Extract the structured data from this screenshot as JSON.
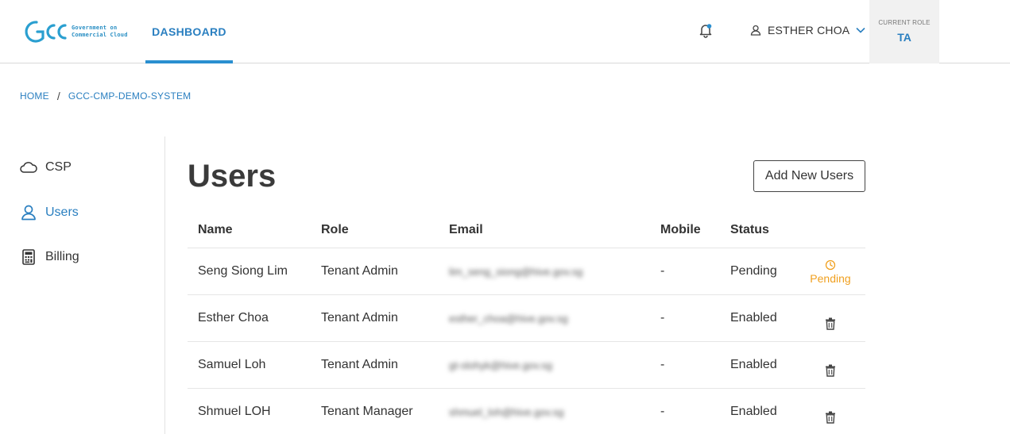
{
  "header": {
    "logo": {
      "mark": "GCC",
      "line1": "Government on",
      "line2": "Commercial Cloud"
    },
    "nav_tab": "DASHBOARD",
    "bell_icon": "bell-icon",
    "user_name": "ESTHER CHOA",
    "role_label": "CURRENT ROLE",
    "role_value": "TA"
  },
  "breadcrumb": {
    "home": "HOME",
    "separator": "/",
    "current": "GCC-CMP-DEMO-SYSTEM"
  },
  "sidebar": {
    "items": [
      {
        "label": "CSP",
        "icon": "cloud-icon",
        "active": false
      },
      {
        "label": "Users",
        "icon": "user-icon",
        "active": true
      },
      {
        "label": "Billing",
        "icon": "calculator-icon",
        "active": false
      }
    ]
  },
  "main": {
    "title": "Users",
    "add_button": "Add New Users",
    "columns": [
      "Name",
      "Role",
      "Email",
      "Mobile",
      "Status"
    ],
    "rows": [
      {
        "name": "Seng Siong Lim",
        "role": "Tenant Admin",
        "email": "lim_seng_siong@hive.gov.sg",
        "mobile": "-",
        "status": "Pending",
        "action": "Pending",
        "action_icon": "clock-icon"
      },
      {
        "name": "Esther Choa",
        "role": "Tenant Admin",
        "email": "esther_choa@hive.gov.sg",
        "mobile": "-",
        "status": "Enabled",
        "action": "",
        "action_icon": "trash-icon"
      },
      {
        "name": "Samuel Loh",
        "role": "Tenant Admin",
        "email": "gt-slohyk@hive.gov.sg",
        "mobile": "-",
        "status": "Enabled",
        "action": "",
        "action_icon": "trash-icon"
      },
      {
        "name": "Shmuel LOH",
        "role": "Tenant Manager",
        "email": "shmuel_loh@hive.gov.sg",
        "mobile": "-",
        "status": "Enabled",
        "action": "",
        "action_icon": "trash-icon"
      }
    ]
  },
  "colors": {
    "accent": "#2a7fc0",
    "pending": "#f0a020"
  }
}
